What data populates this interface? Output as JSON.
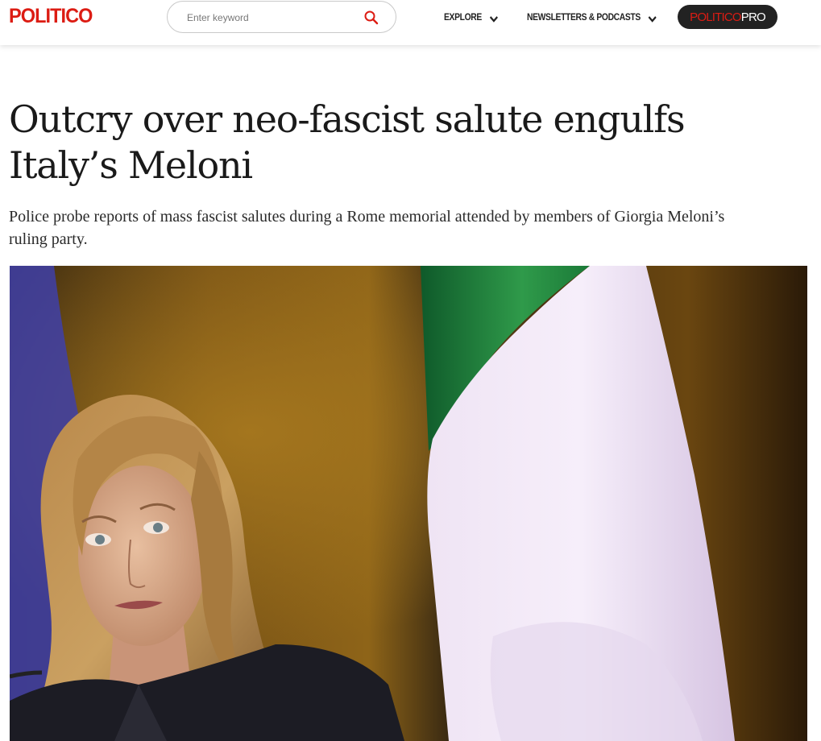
{
  "header": {
    "logo": "POLITICO",
    "search": {
      "placeholder": "Enter keyword"
    },
    "nav": [
      {
        "label": "EXPLORE"
      },
      {
        "label": "NEWSLETTERS & PODCASTS"
      }
    ],
    "pro_button": {
      "part_a": "POLITICO",
      "part_b": "PRO"
    }
  },
  "article": {
    "headline": "Outcry over neo-fascist salute engulfs Italy’s Meloni",
    "dek": "Police probe reports of mass fascist salutes during a Rome memorial attended by members of Giorgia Meloni’s ruling party."
  },
  "colors": {
    "brand_red": "#dc1c13",
    "pro_bg": "#222222"
  },
  "icons": {
    "search": "search-icon",
    "chevron": "chevron-down-icon"
  }
}
